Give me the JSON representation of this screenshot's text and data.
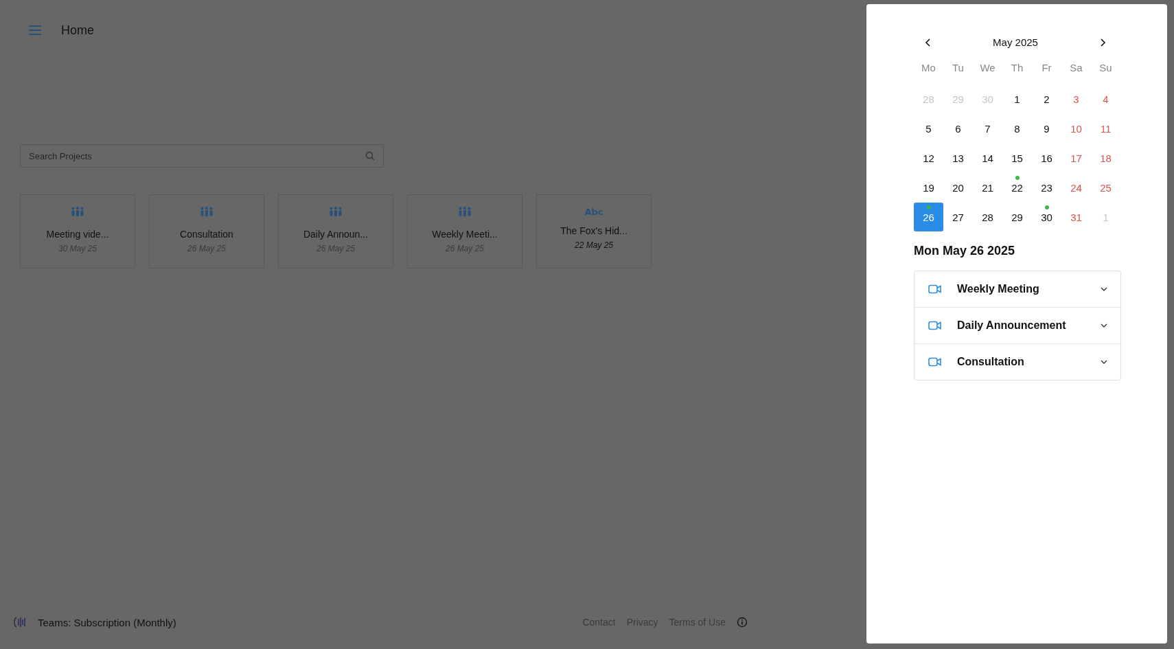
{
  "header": {
    "title": "Home"
  },
  "search": {
    "placeholder": "Search Projects"
  },
  "projects": [
    {
      "kind": "meeting",
      "title": "Meeting vide...",
      "date": "30 May 25"
    },
    {
      "kind": "meeting",
      "title": "Consultation",
      "date": "26 May 25"
    },
    {
      "kind": "meeting",
      "title": "Daily Announ...",
      "date": "26 May 25"
    },
    {
      "kind": "meeting",
      "title": "Weekly Meeti...",
      "date": "26 May 25"
    },
    {
      "kind": "text",
      "title": "The Fox's Hid...",
      "date": "22 May 25",
      "icon_text": "Abc"
    }
  ],
  "footer": {
    "plan": "Teams: Subscription (Monthly)",
    "links": [
      "Contact",
      "Privacy",
      "Terms of Use"
    ]
  },
  "calendar": {
    "month": "May 2025",
    "weekdays": [
      "Mo",
      "Tu",
      "We",
      "Th",
      "Fr",
      "Sa",
      "Su"
    ],
    "weeks": [
      [
        {
          "label": "28",
          "kind": "other",
          "selected": false,
          "event": false
        },
        {
          "label": "29",
          "kind": "other",
          "selected": false,
          "event": false
        },
        {
          "label": "30",
          "kind": "other",
          "selected": false,
          "event": false
        },
        {
          "label": "1",
          "kind": "day",
          "selected": false,
          "event": false
        },
        {
          "label": "2",
          "kind": "day",
          "selected": false,
          "event": false
        },
        {
          "label": "3",
          "kind": "weekend",
          "selected": false,
          "event": false
        },
        {
          "label": "4",
          "kind": "weekend",
          "selected": false,
          "event": false
        }
      ],
      [
        {
          "label": "5",
          "kind": "day",
          "selected": false,
          "event": false
        },
        {
          "label": "6",
          "kind": "day",
          "selected": false,
          "event": false
        },
        {
          "label": "7",
          "kind": "day",
          "selected": false,
          "event": false
        },
        {
          "label": "8",
          "kind": "day",
          "selected": false,
          "event": false
        },
        {
          "label": "9",
          "kind": "day",
          "selected": false,
          "event": false
        },
        {
          "label": "10",
          "kind": "weekend",
          "selected": false,
          "event": false
        },
        {
          "label": "11",
          "kind": "weekend",
          "selected": false,
          "event": false
        }
      ],
      [
        {
          "label": "12",
          "kind": "day",
          "selected": false,
          "event": false
        },
        {
          "label": "13",
          "kind": "day",
          "selected": false,
          "event": false
        },
        {
          "label": "14",
          "kind": "day",
          "selected": false,
          "event": false
        },
        {
          "label": "15",
          "kind": "day",
          "selected": false,
          "event": false
        },
        {
          "label": "16",
          "kind": "day",
          "selected": false,
          "event": false
        },
        {
          "label": "17",
          "kind": "weekend",
          "selected": false,
          "event": false
        },
        {
          "label": "18",
          "kind": "weekend",
          "selected": false,
          "event": false
        }
      ],
      [
        {
          "label": "19",
          "kind": "day",
          "selected": false,
          "event": false
        },
        {
          "label": "20",
          "kind": "day",
          "selected": false,
          "event": false
        },
        {
          "label": "21",
          "kind": "day",
          "selected": false,
          "event": false
        },
        {
          "label": "22",
          "kind": "day",
          "selected": false,
          "event": true
        },
        {
          "label": "23",
          "kind": "day",
          "selected": false,
          "event": false
        },
        {
          "label": "24",
          "kind": "weekend",
          "selected": false,
          "event": false
        },
        {
          "label": "25",
          "kind": "weekend",
          "selected": false,
          "event": false
        }
      ],
      [
        {
          "label": "26",
          "kind": "day",
          "selected": true,
          "event": true
        },
        {
          "label": "27",
          "kind": "day",
          "selected": false,
          "event": false
        },
        {
          "label": "28",
          "kind": "day",
          "selected": false,
          "event": false
        },
        {
          "label": "29",
          "kind": "day",
          "selected": false,
          "event": false
        },
        {
          "label": "30",
          "kind": "day",
          "selected": false,
          "event": true
        },
        {
          "label": "31",
          "kind": "weekend",
          "selected": false,
          "event": false
        },
        {
          "label": "1",
          "kind": "other",
          "selected": false,
          "event": false
        }
      ]
    ]
  },
  "selected_date": "Mon May 26 2025",
  "events": [
    {
      "title": "Weekly Meeting",
      "expanded": false
    },
    {
      "title": "Daily Announcement",
      "expanded": false
    },
    {
      "title": "Consultation",
      "expanded": false
    }
  ]
}
